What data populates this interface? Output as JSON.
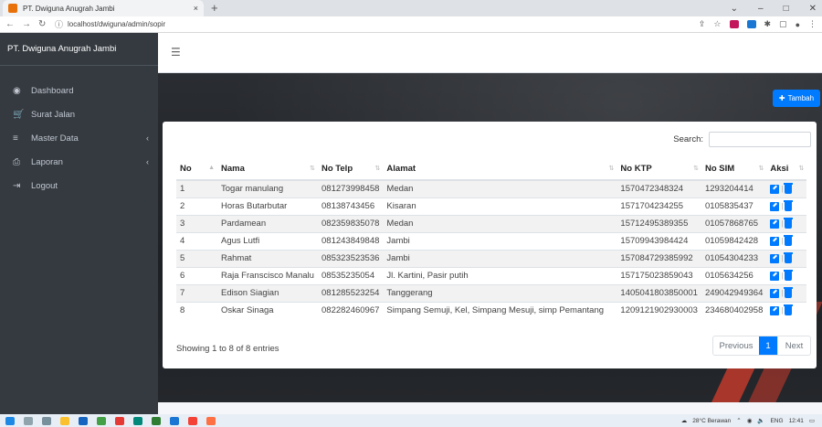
{
  "browser": {
    "tab_title": "PT. Dwiguna Anugrah Jambi",
    "tab_close": "×",
    "new_tab": "+",
    "url": "localhost/dwiguna/admin/sopir"
  },
  "sidebar": {
    "brand": "PT. Dwiguna Anugrah Jambi",
    "items": [
      {
        "label": "Dashboard",
        "icon": "dashboard-icon",
        "glyph": "◉"
      },
      {
        "label": "Surat Jalan",
        "icon": "cart-icon",
        "glyph": "🛒"
      },
      {
        "label": "Master Data",
        "icon": "database-icon",
        "glyph": "≡"
      },
      {
        "label": "Laporan",
        "icon": "print-icon",
        "glyph": "⎙"
      },
      {
        "label": "Logout",
        "icon": "logout-icon",
        "glyph": "⇥"
      }
    ]
  },
  "toolbar": {
    "add_label": "Tambah"
  },
  "search": {
    "label": "Search:",
    "value": ""
  },
  "table": {
    "columns": [
      "No",
      "Nama",
      "No Telp",
      "Alamat",
      "No KTP",
      "No SIM",
      "Aksi"
    ],
    "rows": [
      [
        "1",
        "Togar manulang",
        "081273998458",
        "Medan",
        "1570472348324",
        "1293204414"
      ],
      [
        "2",
        "Horas Butarbutar",
        "08138743456",
        "Kisaran",
        "1571704234255",
        "0105835437"
      ],
      [
        "3",
        "Pardamean",
        "082359835078",
        "Medan",
        "15712495389355",
        "01057868765"
      ],
      [
        "4",
        "Agus Lutfi",
        "081243849848",
        "Jambi",
        "15709943984424",
        "01059842428"
      ],
      [
        "5",
        "Rahmat",
        "085323523536",
        "Jambi",
        "157084729385992",
        "01054304233"
      ],
      [
        "6",
        "Raja Franscisco Manalu",
        "08535235054",
        "Jl. Kartini, Pasir putih",
        "157175023859043",
        "0105634256"
      ],
      [
        "7",
        "Edison Siagian",
        "081285523254",
        "Tanggerang",
        "1405041803850001",
        "249042949364"
      ],
      [
        "8",
        "Oskar Sinaga",
        "082282460967",
        "Simpang Semuji, Kel, Simpang Mesuji, simp Pemantang",
        "1209121902930003",
        "234680402958"
      ]
    ]
  },
  "footer": {
    "info": "Showing 1 to 8 of 8 entries",
    "prev": "Previous",
    "page": "1",
    "next": "Next"
  },
  "taskbar": {
    "weather": "28°C Berawan",
    "lang": "ENG",
    "time": "12:41"
  },
  "colors": {
    "sidebar": "#343a40",
    "primary": "#007bff"
  }
}
